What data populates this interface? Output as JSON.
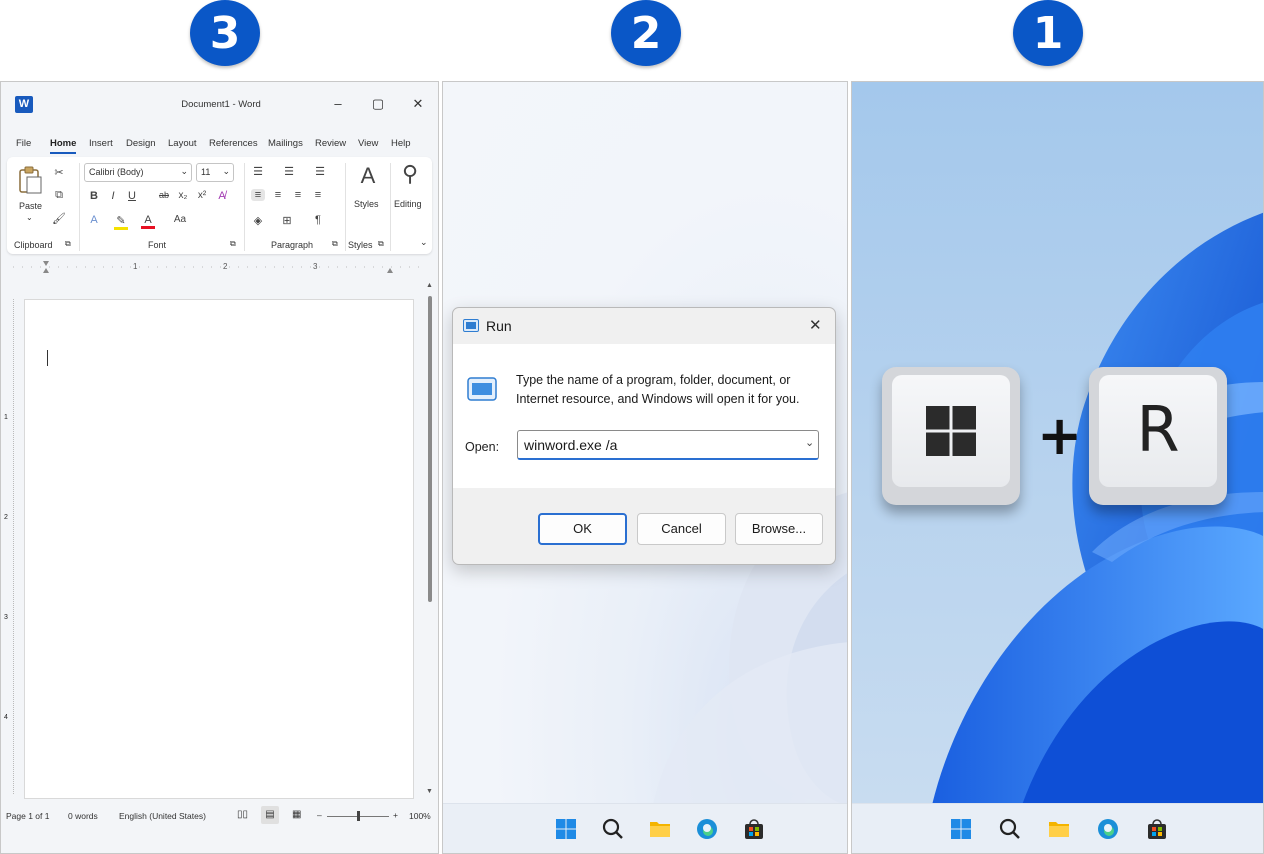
{
  "steps": [
    "3",
    "2",
    "1"
  ],
  "word": {
    "title": "Document1  -  Word",
    "logo_letter": "W",
    "window_controls": [
      "–",
      "▢",
      "✕"
    ],
    "tabs": [
      "File",
      "Home",
      "Insert",
      "Design",
      "Layout",
      "References",
      "Mailings",
      "Review",
      "View",
      "Help"
    ],
    "active_tab": "Home",
    "clipboard": {
      "paste_label": "Paste",
      "group_label": "Clipboard"
    },
    "font": {
      "family": "Calibri (Body)",
      "size": "11",
      "group_label": "Font",
      "format_buttons": [
        "B",
        "I",
        "U",
        "ab",
        "x₂",
        "x²"
      ],
      "case_label": "Aa"
    },
    "paragraph": {
      "group_label": "Paragraph",
      "pilcrow": "¶"
    },
    "styles": {
      "label": "Styles",
      "group_label": "Styles"
    },
    "editing": {
      "label": "Editing"
    },
    "ruler_numbers": [
      "1",
      "2",
      "3"
    ],
    "vertical_ruler_numbers": [
      "1",
      "2",
      "3",
      "4"
    ],
    "status": {
      "page": "Page 1 of 1",
      "words": "0 words",
      "language": "English (United States)",
      "zoom": "100%",
      "zoom_minus": "–",
      "zoom_plus": "+"
    }
  },
  "run_dialog": {
    "title": "Run",
    "description": "Type the name of a program, folder, document, or Internet resource, and Windows will open it for you.",
    "open_label": "Open:",
    "input_value": "winword.exe /a",
    "ok": "OK",
    "cancel": "Cancel",
    "browse": "Browse...",
    "close": "✕"
  },
  "taskbar_icons": [
    "windows-start-icon",
    "search-icon",
    "file-explorer-icon",
    "edge-icon",
    "store-icon"
  ],
  "shortcut": {
    "key2": "R",
    "plus": "+"
  },
  "colors": {
    "badge": "#0a57c7",
    "word_blue": "#185abd",
    "dialog_accent": "#2a6fd1",
    "desktop_blue": "#1a64e0"
  }
}
